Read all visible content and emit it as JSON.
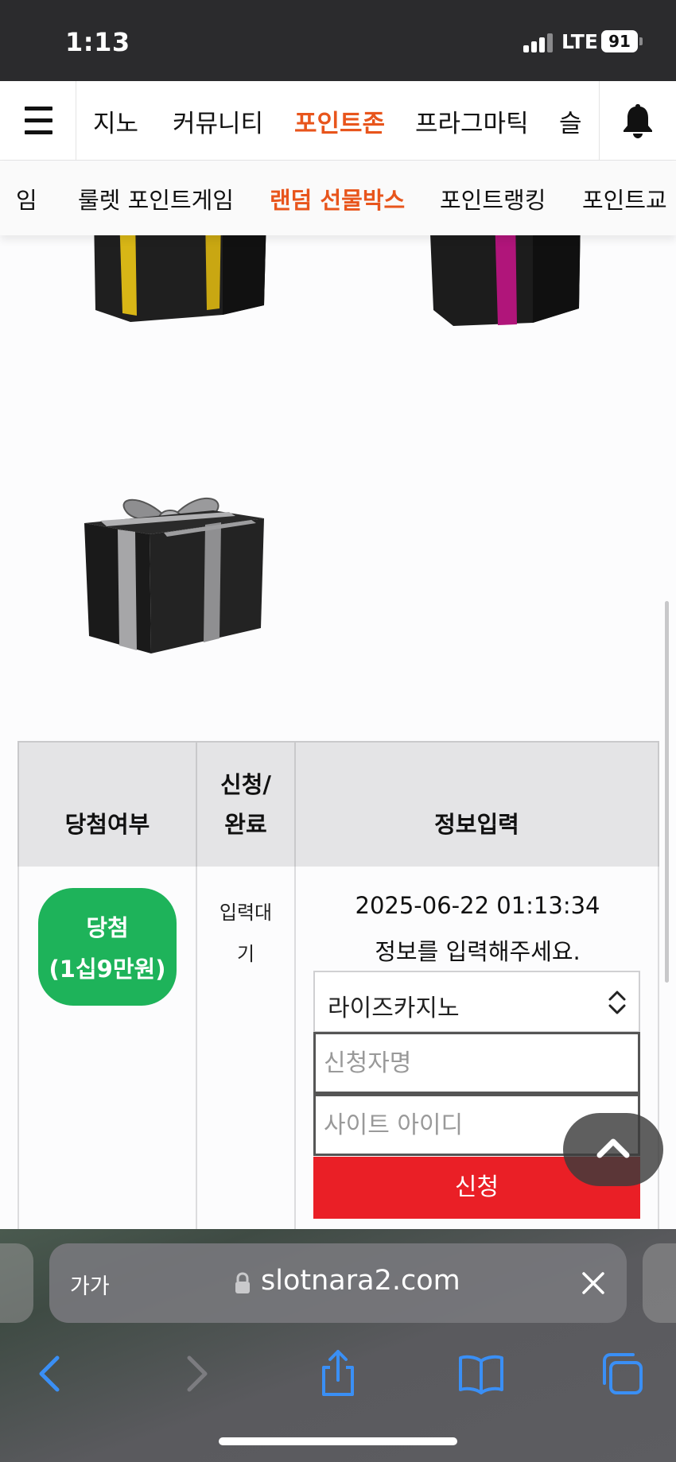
{
  "status_bar": {
    "time": "1:13",
    "network": "LTE",
    "battery": "91"
  },
  "top_nav": {
    "items": [
      "지노",
      "커뮤니티",
      "포인트존",
      "프라그마틱",
      "슬"
    ],
    "active": "포인트존"
  },
  "sub_nav": {
    "items": [
      "임",
      "룰렛 포인트게임",
      "랜덤 선물박스",
      "포인트랭킹",
      "포인트교"
    ],
    "active": "랜덤 선물박스"
  },
  "gifts": [
    {
      "name": "gift-yellow",
      "ribbon_color": "#d8b616"
    },
    {
      "name": "gift-magenta",
      "ribbon_color": "#b0157a"
    },
    {
      "name": "gift-silver",
      "ribbon_color": "#a6a6a8"
    }
  ],
  "table": {
    "headers": {
      "result": "당첨여부",
      "status_line1": "신청/",
      "status_line2": "완료",
      "info": "정보입력"
    },
    "row": {
      "result_line1": "당첨",
      "result_line2": "(1십9만원)",
      "status_line1": "입력대",
      "status_line2": "기",
      "datetime": "2025-06-22 01:13:34",
      "instruction": "정보를 입력해주세요.",
      "site_select": "라이즈카지노",
      "name_placeholder": "신청자명",
      "id_placeholder": "사이트 아이디",
      "apply_label": "신청"
    }
  },
  "browser": {
    "text_size_label": "가가",
    "url": "slotnara2.com"
  },
  "colors": {
    "accent": "#e8551c",
    "win": "#1eb35a",
    "apply": "#ea1f26",
    "ios_blue": "#3a8ff5"
  }
}
